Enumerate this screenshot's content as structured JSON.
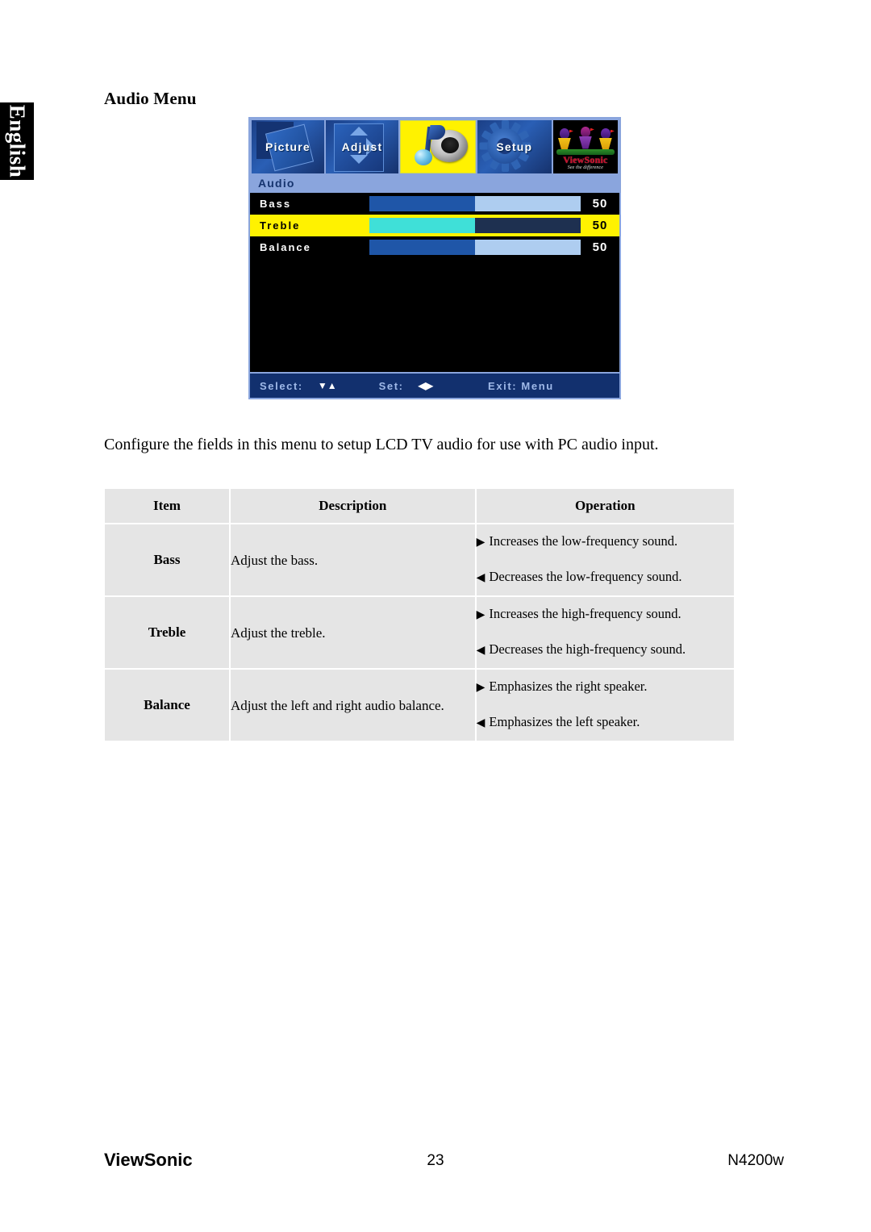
{
  "sidebar_tab": {
    "label": "English"
  },
  "page_title": "Audio Menu",
  "osd": {
    "tabs": [
      {
        "name": "picture",
        "label": "Picture",
        "selected": false
      },
      {
        "name": "adjust",
        "label": "Adjust",
        "selected": false
      },
      {
        "name": "audio",
        "label": "",
        "selected": true
      },
      {
        "name": "setup",
        "label": "Setup",
        "selected": false
      }
    ],
    "logo": {
      "brand": "ViewSonic",
      "tagline": "See the difference"
    },
    "section_label": "Audio",
    "rows": [
      {
        "label": "Bass",
        "value": "50",
        "fill_percent": 50,
        "selected": false
      },
      {
        "label": "Treble",
        "value": "50",
        "fill_percent": 50,
        "selected": true
      },
      {
        "label": "Balance",
        "value": "50",
        "fill_percent": 50,
        "selected": false
      }
    ],
    "footer": {
      "select_label": "Select:",
      "select_icons": "▼▲",
      "set_label": "Set:",
      "set_icons": "◀▶",
      "exit_label": "Exit: Menu"
    },
    "colors": {
      "highlight_yellow": "#fff200",
      "bar_fill": "#1f56a8",
      "bar_rest": "#aecdf0",
      "bar_fill_selected": "#3fe0d8",
      "bar_rest_selected": "#1e3050",
      "panel_border": "#8aa5dd",
      "footer_bg": "#12306e"
    }
  },
  "intro": "Configure the fields in this menu to setup LCD TV audio for use with PC audio input.",
  "table": {
    "headers": [
      "Item",
      "Description",
      "Operation"
    ],
    "rows": [
      {
        "item": "Bass",
        "description": "Adjust the bass.",
        "op_increase": "Increases the low-frequency sound.",
        "op_decrease": "Decreases the low-frequency sound.",
        "arrow_right": "▶",
        "arrow_left": "◀"
      },
      {
        "item": "Treble",
        "description": "Adjust the treble.",
        "op_increase": "Increases the high-frequency sound.",
        "op_decrease": "Decreases the high-frequency sound.",
        "arrow_right": "▶",
        "arrow_left": "◀"
      },
      {
        "item": "Balance",
        "description": "Adjust the left and right audio balance.",
        "op_increase": "Emphasizes the right speaker.",
        "op_decrease": "Emphasizes the left speaker.",
        "arrow_right": "▶",
        "arrow_left": "◀"
      }
    ]
  },
  "footer": {
    "brand": "ViewSonic",
    "page_number": "23",
    "model": "N4200w"
  }
}
